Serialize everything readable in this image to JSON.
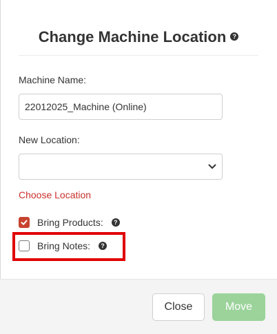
{
  "dialog": {
    "title": "Change Machine Location",
    "help_glyph": "?"
  },
  "fields": {
    "machine_name": {
      "label": "Machine Name:",
      "value": "22012025_Machine (Online)"
    },
    "new_location": {
      "label": "New Location:",
      "selected": "",
      "error": "Choose Location"
    }
  },
  "options": {
    "bring_products": {
      "label": "Bring Products:",
      "checked": true
    },
    "bring_notes": {
      "label": "Bring Notes:",
      "checked": false
    }
  },
  "footer": {
    "close_label": "Close",
    "move_label": "Move"
  },
  "colors": {
    "error": "#c9302c",
    "checkbox_checked": "#c8432f",
    "move_button_disabled": "#9bd39b",
    "highlight": "#e00000"
  },
  "icons": {
    "help": "question-circle-icon",
    "dropdown": "chevron-down-icon",
    "check": "check-icon"
  }
}
